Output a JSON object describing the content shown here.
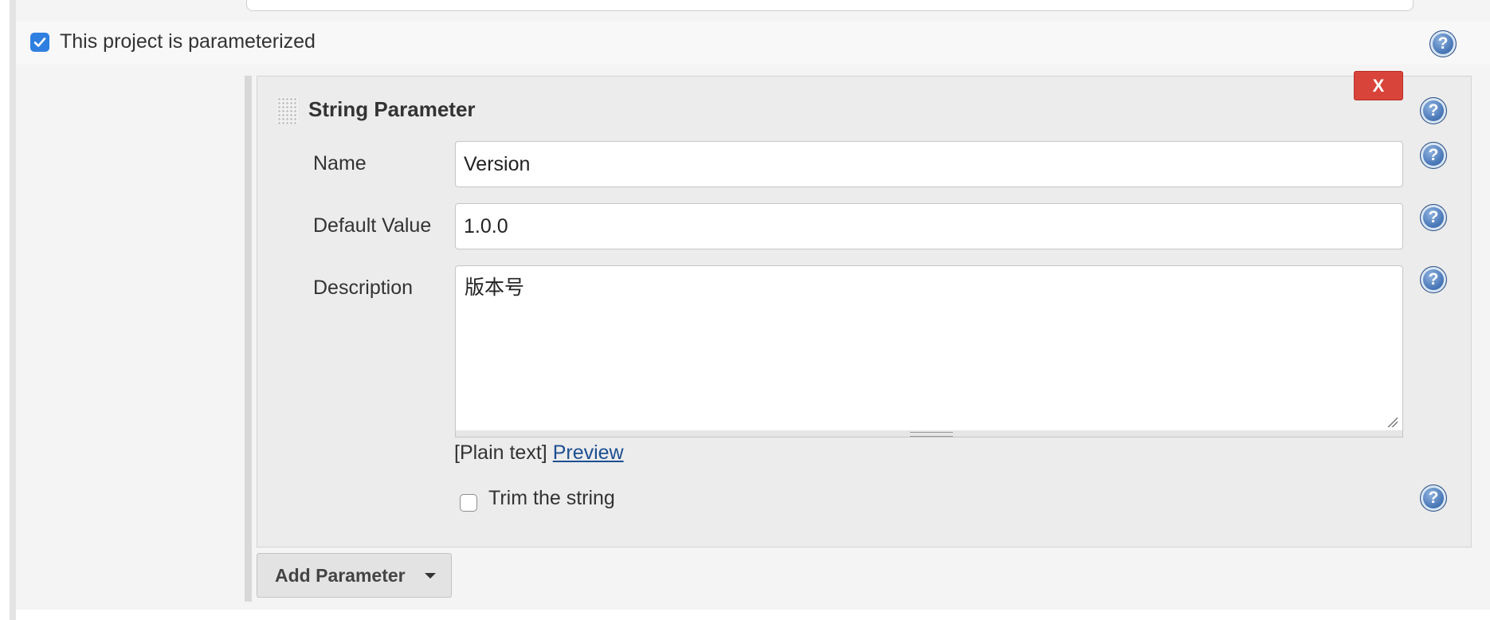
{
  "parameterized": {
    "label": "This project is parameterized",
    "checked": true
  },
  "parameter": {
    "title": "String Parameter",
    "delete_label": "X",
    "fields": {
      "name": {
        "label": "Name",
        "value": "Version"
      },
      "default_value": {
        "label": "Default Value",
        "value": "1.0.0"
      },
      "description": {
        "label": "Description",
        "value": "版本号"
      }
    },
    "markup": {
      "mode": "[Plain text]",
      "preview_link": "Preview"
    },
    "trim": {
      "label": "Trim the string",
      "checked": false
    }
  },
  "add_parameter": {
    "label": "Add Parameter"
  },
  "help_glyph": "?",
  "colors": {
    "checkbox_accent": "#2f7fe0",
    "delete_button": "#d9443a",
    "link": "#1d4f91"
  }
}
